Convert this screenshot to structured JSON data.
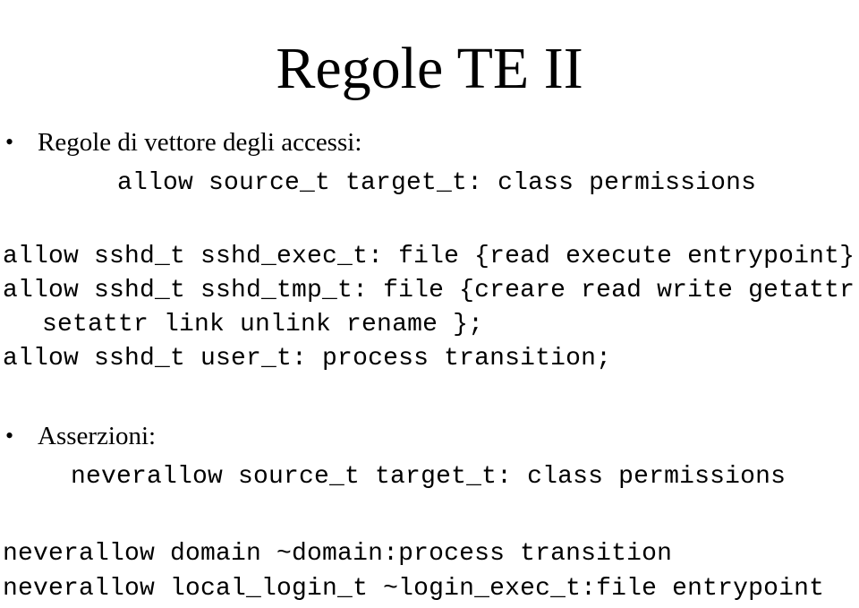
{
  "slide": {
    "title": "Regole TE II",
    "bullets": [
      {
        "marker": "•",
        "label": "Regole di vettore degli accessi:"
      },
      {
        "marker": "•",
        "label": "Asserzioni:"
      }
    ],
    "access_vector_rules": {
      "syntax_template": "allow source_t target_t: class permissions",
      "examples": [
        "allow sshd_t sshd_exec_t: file {read execute entrypoint};",
        "allow sshd_t sshd_tmp_t: file {creare read write getattr",
        "setattr link unlink rename };",
        "allow sshd_t user_t: process transition;"
      ]
    },
    "assertions": {
      "syntax_template": "neverallow source_t target_t: class permissions",
      "examples": [
        "neverallow domain ~domain:process transition",
        "neverallow local_login_t ~login_exec_t:file entrypoint"
      ]
    }
  }
}
